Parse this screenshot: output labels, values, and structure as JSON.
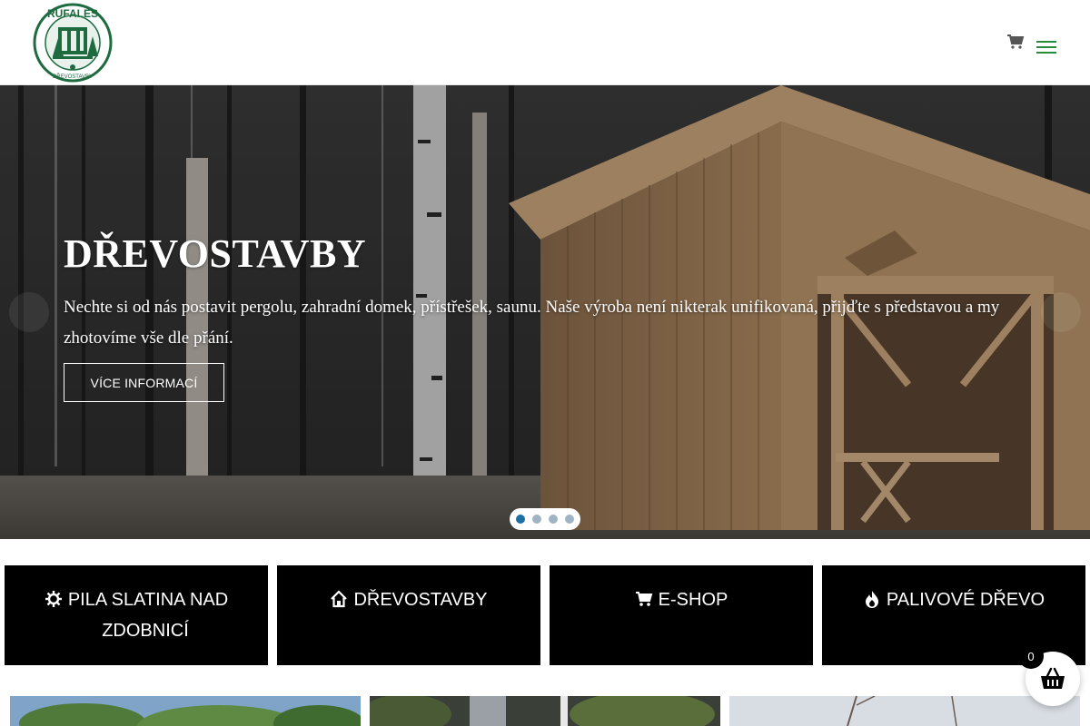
{
  "header": {
    "logo_text": "RUFALES",
    "logo_subtext": "DŘEVOSTAVBY",
    "cart_icon": "cart-icon",
    "menu_icon": "hamburger-menu-icon",
    "accent_color": "#2a8a3e"
  },
  "hero": {
    "title": "DŘEVOSTAVBY",
    "text": "Nechte si od nás postavit pergolu, zahradní domek, přístřešek, saunu. Naše výroba není nikterak unifikovaná, přijďte s představou a my zhotovíme vše dle přání.",
    "button_label": "VÍCE INFORMACÍ",
    "slides_total": 4,
    "active_slide": 1
  },
  "tiles": [
    {
      "icon": "saw-blade-icon",
      "line1": "PILA SLATINA NAD",
      "line2": "ZDOBNICÍ"
    },
    {
      "icon": "home-icon",
      "line1": "DŘEVOSTAVBY"
    },
    {
      "icon": "cart-icon",
      "line1": "E-SHOP"
    },
    {
      "icon": "flame-icon",
      "line1": "PALIVOVÉ DŘEVO"
    }
  ],
  "basket": {
    "count": "0",
    "icon": "basket-icon"
  }
}
